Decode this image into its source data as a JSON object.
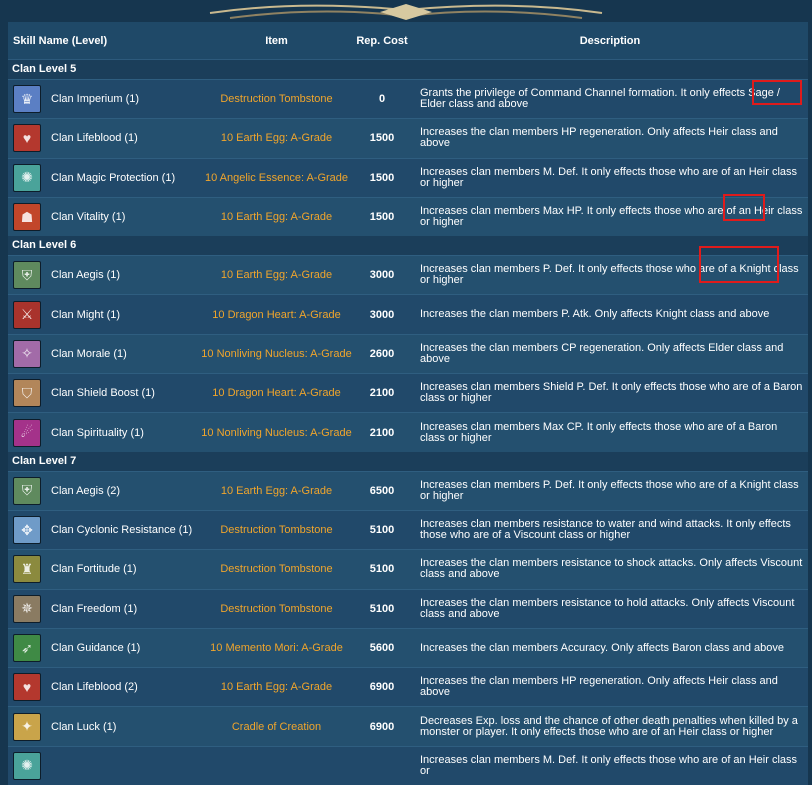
{
  "header": {
    "skill": "Skill Name (Level)",
    "item": "Item",
    "cost": "Rep. Cost",
    "description": "Description"
  },
  "sections": [
    {
      "title": "Clan Level 5",
      "rows": [
        {
          "name": "Clan Imperium (1)",
          "item": "Destruction Tombstone",
          "cost": "0",
          "desc": "Grants the privilege of Command Channel formation. It only effects Sage / Elder class and above",
          "icon": "crown-icon",
          "icon_color": "#5b7fc4"
        },
        {
          "name": "Clan Lifeblood (1)",
          "item": "10 Earth Egg: A-Grade",
          "cost": "1500",
          "desc": "Increases the clan members HP regeneration. Only affects Heir class and above",
          "icon": "heart-icon",
          "icon_color": "#b4382e"
        },
        {
          "name": "Clan Magic Protection (1)",
          "item": "10 Angelic Essence: A-Grade",
          "cost": "1500",
          "desc": "Increases clan members M. Def. It only effects those who are of an Heir class or higher",
          "icon": "magic-shield-icon",
          "icon_color": "#4aa39a"
        },
        {
          "name": "Clan Vitality (1)",
          "item": "10 Earth Egg: A-Grade",
          "cost": "1500",
          "desc": "Increases clan members Max HP. It only effects those who are of an Heir class or higher",
          "icon": "vitality-icon",
          "icon_color": "#c2462a"
        }
      ]
    },
    {
      "title": "Clan Level 6",
      "rows": [
        {
          "name": "Clan Aegis (1)",
          "item": "10 Earth Egg: A-Grade",
          "cost": "3000",
          "desc": "Increases clan members P. Def. It only effects those who are of a Knight class or higher",
          "icon": "aegis-icon",
          "icon_color": "#5f8a5e"
        },
        {
          "name": "Clan Might (1)",
          "item": "10 Dragon Heart: A-Grade",
          "cost": "3000",
          "desc": "Increases the clan members P. Atk. Only affects Knight class and above",
          "icon": "might-icon",
          "icon_color": "#a9332c"
        },
        {
          "name": "Clan Morale (1)",
          "item": "10 Nonliving Nucleus: A-Grade",
          "cost": "2600",
          "desc": "Increases the clan members CP regeneration. Only affects Elder class and above",
          "icon": "morale-icon",
          "icon_color": "#a26ba8"
        },
        {
          "name": "Clan Shield Boost (1)",
          "item": "10 Dragon Heart: A-Grade",
          "cost": "2100",
          "desc": "Increases clan members Shield P. Def. It only effects those who are of a Baron class or higher",
          "icon": "shield-icon",
          "icon_color": "#b2865a"
        },
        {
          "name": "Clan Spirituality (1)",
          "item": "10 Nonliving Nucleus: A-Grade",
          "cost": "2100",
          "desc": "Increases clan members Max CP. It only effects those who are of a Baron class or higher",
          "icon": "spirit-icon",
          "icon_color": "#a4328a"
        }
      ]
    },
    {
      "title": "Clan Level 7",
      "rows": [
        {
          "name": "Clan Aegis (2)",
          "item": "10 Earth Egg: A-Grade",
          "cost": "6500",
          "desc": "Increases clan members P. Def. It only effects those who are of a Knight class or higher",
          "icon": "aegis-icon",
          "icon_color": "#5f8a5e"
        },
        {
          "name": "Clan Cyclonic Resistance (1)",
          "item": "Destruction Tombstone",
          "cost": "5100",
          "desc": "Increases clan members resistance to water and wind attacks. It only effects those who are of a Viscount class or higher",
          "icon": "cyclone-icon",
          "icon_color": "#6f9bc8"
        },
        {
          "name": "Clan Fortitude (1)",
          "item": "Destruction Tombstone",
          "cost": "5100",
          "desc": "Increases the clan members resistance to shock attacks. Only affects Viscount class and above",
          "icon": "fortitude-icon",
          "icon_color": "#8b8a3e"
        },
        {
          "name": "Clan Freedom (1)",
          "item": "Destruction Tombstone",
          "cost": "5100",
          "desc": "Increases the clan members resistance to hold attacks. Only affects Viscount class and above",
          "icon": "freedom-icon",
          "icon_color": "#8a7b62"
        },
        {
          "name": "Clan Guidance (1)",
          "item": "10 Memento Mori: A-Grade",
          "cost": "5600",
          "desc": "Increases the clan members Accuracy. Only affects Baron class and above",
          "icon": "guidance-icon",
          "icon_color": "#3f8a45"
        },
        {
          "name": "Clan Lifeblood (2)",
          "item": "10 Earth Egg: A-Grade",
          "cost": "6900",
          "desc": "Increases the clan members HP regeneration. Only affects Heir class and above",
          "icon": "heart-icon",
          "icon_color": "#b4382e"
        },
        {
          "name": "Clan Luck (1)",
          "item": "Cradle of Creation",
          "cost": "6900",
          "desc": "Decreases Exp. loss and the chance of other death penalties when killed by a monster or player. It only effects those who are of an Heir class or higher",
          "icon": "luck-icon",
          "icon_color": "#c9a44a"
        },
        {
          "name": "",
          "item": "",
          "cost": "",
          "desc": "Increases clan members M. Def. It only effects those who are of an Heir class or",
          "icon": "magic-shield-icon",
          "icon_color": "#4aa39a"
        }
      ]
    }
  ]
}
